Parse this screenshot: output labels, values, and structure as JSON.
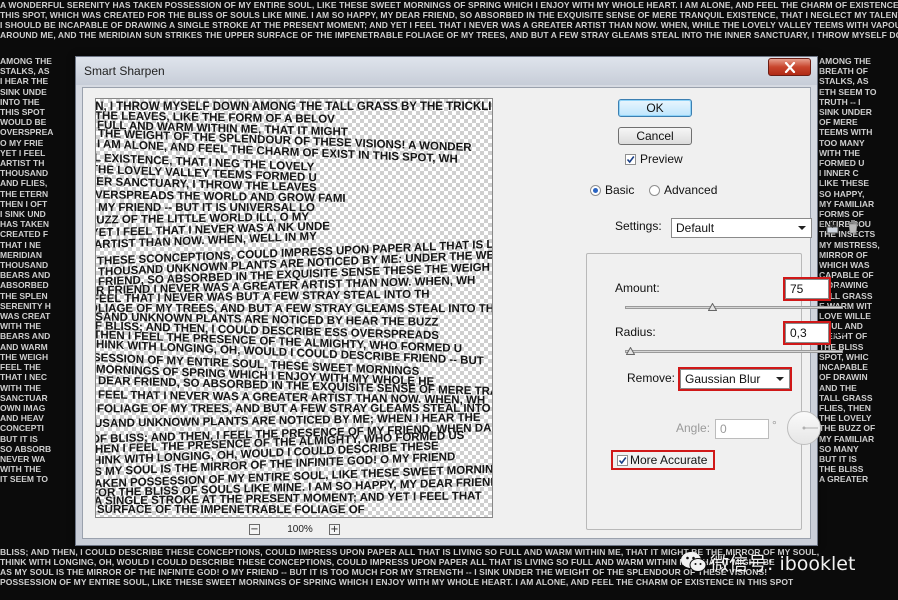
{
  "window": {
    "title": "Smart Sharpen"
  },
  "buttons": {
    "ok": "OK",
    "cancel": "Cancel"
  },
  "preview": {
    "label": "Preview",
    "checked": true,
    "zoom": "100%",
    "zoom_out": "−",
    "zoom_in": "+"
  },
  "mode": {
    "basic": "Basic",
    "advanced": "Advanced",
    "selected": "basic"
  },
  "settings": {
    "label": "Settings:",
    "value": "Default"
  },
  "amount": {
    "label": "Amount:",
    "value": "75",
    "unit": "%",
    "fraction": 0.16
  },
  "radius": {
    "label": "Radius:",
    "value": "0,3",
    "unit": "px",
    "fraction": 0.0
  },
  "remove": {
    "label": "Remove:",
    "value": "Gaussian Blur"
  },
  "angle": {
    "label": "Angle:",
    "value": "0",
    "unit": "°"
  },
  "more_accurate": {
    "label": "More Accurate",
    "checked": true
  },
  "watermark": {
    "text": "微信号: ibooklet"
  },
  "colors": {
    "highlight": "#d01818",
    "dialog_bg": "#f0f0f0",
    "ok_blue": "#bee6fd",
    "background": "#0b0b0b"
  },
  "background_text": {
    "top": [
      "A WONDERFUL SERENITY HAS TAKEN POSSESSION OF MY ENTIRE SOUL, LIKE THESE SWEET MORNINGS OF SPRING WHICH I ENJOY WITH MY WHOLE HEART. I AM ALONE, AND FEEL THE CHARM OF EXISTENCE IN",
      "THIS SPOT, WHICH WAS CREATED FOR THE BLISS OF SOULS LIKE MINE. I AM SO HAPPY, MY DEAR FRIEND, SO ABSORBED IN THE EXQUISITE SENSE OF MERE TRANQUIL EXISTENCE, THAT I NEGLECT MY TALENTS.",
      "I SHOULD BE INCAPABLE OF DRAWING A SINGLE STROKE AT THE PRESENT MOMENT; AND YET I FEEL THAT I NEVER WAS A GREATER ARTIST THAN NOW. WHEN, WHILE THE LOVELY VALLEY TEEMS WITH VAPOUR",
      "AROUND ME, AND THE MERIDIAN SUN STRIKES THE UPPER SURFACE OF THE IMPENETRABLE FOLIAGE OF MY TREES, AND BUT A FEW STRAY GLEAMS STEAL INTO THE INNER SANCTUARY, I THROW MYSELF DOWN"
    ],
    "bottom": [
      "BLISS; AND THEN, I COULD DESCRIBE THESE CONCEPTIONS, COULD IMPRESS UPON PAPER ALL THAT IS LIVING SO FULL AND WARM WITHIN ME, THAT IT MIGHT BE THE MIRROR OF MY SOUL,",
      "THINK WITH LONGING, OH, WOULD I COULD DESCRIBE THESE CONCEPTIONS, COULD IMPRESS UPON PAPER ALL THAT IS LIVING SO FULL AND WARM WITHIN ME, THAT IT MIGHT BE",
      "AS MY SOUL IS THE MIRROR OF THE INFINITE GOD! O MY FRIEND -- BUT IT IS TOO MUCH FOR MY STRENGTH -- I SINK UNDER THE WEIGHT OF THE SPLENDOUR OF THESE VISIONS!",
      "POSSESSION OF MY ENTIRE SOUL, LIKE THESE SWEET MORNINGS OF SPRING WHICH I ENJOY WITH MY WHOLE HEART. I AM ALONE, AND FEEL THE CHARM OF EXISTENCE IN THIS SPOT"
    ],
    "left": [
      "AMONG THE",
      "STALKS, AS",
      "I HEAR THE",
      "SINK UNDE",
      "INTO THE",
      "THIS SPOT",
      "WOULD BE",
      "OVERSPREA",
      "O MY FRIE",
      "YET I FEEL",
      "ARTIST TH",
      "THOUSAND",
      "AND FLIES,",
      "THE ETERN",
      "THEN I OFT",
      "I SINK UND",
      "HAS TAKEN",
      "CREATED F",
      "THAT I NE",
      "MERIDIAN",
      "THOUSAND",
      "BEARS AND",
      "ABSORBED",
      "THE SPLEN",
      "SERENITY H",
      "WAS CREAT",
      "WITH THE",
      "BEARS AND",
      "AND WARM",
      "THE WEIGH",
      "FEEL THE",
      "THAT I NEC",
      "WITH THE",
      "SANCTUAR",
      "OWN IMAG",
      "AND HEAV",
      "CONCEPTI",
      "BUT IT IS",
      "SO ABSORB",
      "NEVER WA",
      "WITH THE",
      "IT SEEM TO"
    ],
    "right": [
      "AMONG THE",
      "BREATH OF",
      "STALKS, AS",
      "ETH SEEM TO",
      "TRUTH -- I",
      "SINK UNDER",
      "OF MERE",
      "TEEMS WITH",
      "TOO MANY",
      "WITH THE",
      "FORMED U",
      "I INNER C",
      "LIKE THESE",
      "SO HAPPY,",
      "MY FAMILIAR",
      "FORMS OF",
      "ENTIRE SOU",
      "THE INSECTS",
      "MY MISTRESS,",
      "MIRROR OF",
      "WHICH WAS",
      "CAPABLE OF",
      "A DRAWING",
      "TALL GRASS",
      "E WARM WIT",
      "LOVE WILLE",
      "SOUL AND",
      "WEIGHT OF",
      "THE BLISS",
      "SPOT, WHIC",
      "INCAPABLE",
      "OF DRAWIN",
      "AND THE",
      "TALL GRASS",
      "FLIES, THEN",
      "THE LOVELY",
      "THE BUZZ OF",
      "MY FAMILIAR",
      "SO MANY",
      "BUT IT IS",
      "THE BLISS",
      "A GREATER"
    ]
  },
  "preview_text": [
    "IN, I THROW MYSELF DOWN AMONG THE TALL GRASS BY THE TRICKLING",
    "THE LEAVES, LIKE THE FORM OF A BELOV",
    "FULL AND WARM WITHIN ME, THAT IT MIGHT",
    "THE WEIGHT OF THE SPLENDOUR OF THESE VISIONS! A WONDER",
    "I AM ALONE, AND FEEL THE CHARM OF EXIST IN THIS SPOT, WH",
    "L EXISTENCE, THAT I NEG        THE LOVELY",
    "THE LOVELY VALLEY TEEMS                    FORMED U",
    "NER SANCTUARY, I THROW            THE LEAVES",
    "OVERSPREADS THE WORLD              AND GROW FAMI",
    "O MY FRIEND -- BUT IT IS              UNIVERSAL LO",
    "BUZZ OF THE LITTLE WORLD               ILL, O MY",
    "YET I FEEL THAT I NEVER WAS A            NK UNDE",
    "ARTIST THAN NOW. WHEN,                  WELL IN MY",
    "THESE SCONCEPTIONS, COULD IMPRESS UPON PAPER ALL THAT IS LIV",
    "THOUSAND UNKNOWN PLANTS ARE NOTICED BY ME:  UNDER THE WE",
    "FRIEND, SO ABSORBED IN THE EXQUISITE SENSE  THESE THE WEIGH",
    "R FRIEND   I NEVER WAS A GREATER ARTIST THAN NOW. WHEN, WH",
    "FEEL THAT I NEVER WAS     BUT A FEW STRAY      STEAL INTO TH",
    "OLIAGE OF MY TREES, AND BUT A FEW STRAY GLEAMS  STEAL INTO TH",
    "USAND UNKNOWN PLANTS ARE NOTICED BY   HEAR THE BUZZ",
    "OF BLISS; AND THEN, I COULD DESCRIBE  ESS OVERSPREADS",
    "I THEN I FEEL THE PRESENCE OF THE ALMIGHTY, WHO FORMED U",
    "THINK WITH LONGING, OH, WOULD I COULD DESCRIBE  FRIEND -- BUT",
    "SESSION OF MY ENTIRE SOUL,  THESE SWEET MORNINGS",
    "MORNINGS OF SPRING WHICH I ENJOY WITH MY WHOLE HE",
    "DEAR FRIEND, SO ABSORBED IN THE EXQUISITE SENSE OF MERE TRANQUIL",
    "FEEL THAT I NEVER WAS A GREATER ARTIST THAN NOW. WHEN, WH",
    "FOLIAGE OF MY TREES, AND BUT A FEW STRAY GLEAMS STEAL INTO THE",
    "USAND UNKNOWN PLANTS ARE NOTICED BY ME; WHEN I HEAR THE",
    "OF BLISS; AND THEN, I FEEL THE PRESENCE OF MY FRIEND, WHEN DARKNESS OVERSPREADS",
    "THEN I FEEL THE PRESENCE OF THE ALMIGHTY, WHO FORMED US",
    "THINK WITH LONGING, OH, WOULD I COULD DESCRIBE THESE",
    "AS MY SOUL IS THE MIRROR OF THE INFINITE GOD! O MY FRIEND",
    "TAKEN POSSESSION OF MY ENTIRE SOUL, LIKE THESE SWEET MORNING",
    "FOR THE BLISS OF SOULS LIKE MINE. I AM SO HAPPY, MY DEAR FRIEND,",
    "A SINGLE STROKE AT THE PRESENT MOMENT; AND YET I FEEL THAT",
    "SURFACE OF THE IMPENETRABLE FOLIAGE OF"
  ]
}
